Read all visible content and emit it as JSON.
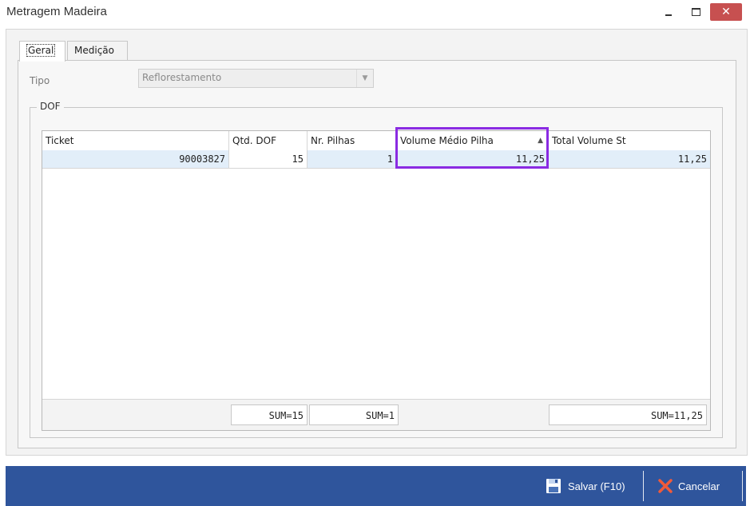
{
  "window": {
    "title": "Metragem Madeira",
    "close_glyph": "✕"
  },
  "tabs": [
    {
      "label": "Geral"
    },
    {
      "label": "Medição"
    }
  ],
  "form": {
    "tipo_label": "Tipo",
    "tipo_value": "Reflorestamento"
  },
  "dof": {
    "legend": "DOF"
  },
  "grid": {
    "columns": [
      "Ticket",
      "Qtd. DOF",
      "Nr. Pilhas",
      "Volume Médio Pilha",
      "Total Volume St"
    ],
    "sort_glyph": "▲",
    "rows": [
      {
        "ticket": "90003827",
        "qtd_dof": "15",
        "nr_pilhas": "1",
        "volume_medio": "11,25",
        "total_volume": "11,25"
      }
    ],
    "sums": {
      "qtd_dof": "SUM=15",
      "nr_pilhas": "SUM=1",
      "total_volume": "SUM=11,25"
    }
  },
  "actions": {
    "save_label": "Salvar (F10)",
    "cancel_label": "Cancelar"
  },
  "colors": {
    "statusbar": "#2f559c",
    "highlight": "#8a2be2",
    "row_selected": "#e2eef9",
    "close_button": "#c75050"
  }
}
